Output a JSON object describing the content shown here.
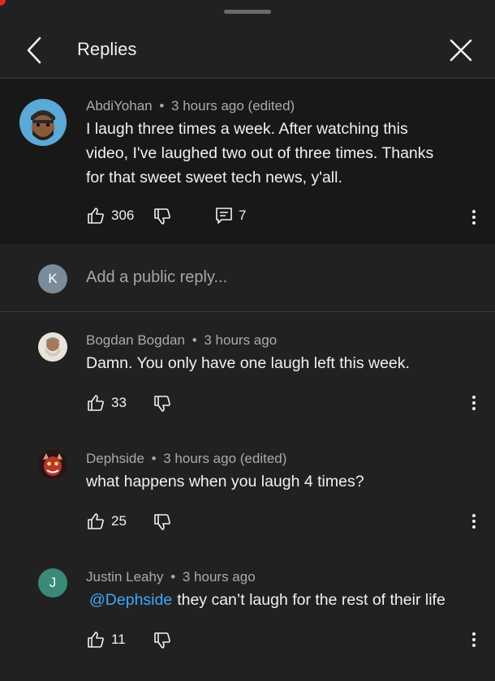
{
  "header": {
    "title": "Replies",
    "back_icon": "chevron-left-icon",
    "close_icon": "close-icon"
  },
  "parent_comment": {
    "author": "AbdiYohan",
    "time": "3 hours ago (edited)",
    "text_lines": [
      "I laugh three times a week. After watching this",
      "video, I've laughed two out of three times. Thanks",
      "for that sweet sweet tech news, y'all."
    ],
    "likes": "306",
    "reply_count": "7"
  },
  "reply_input": {
    "avatar_letter": "K",
    "placeholder": "Add a public reply..."
  },
  "replies": [
    {
      "author": "Bogdan Bogdan",
      "time": "3 hours ago",
      "text": "Damn. You only have one laugh left this week.",
      "likes": "33"
    },
    {
      "author": "Dephside",
      "time": "3 hours ago (edited)",
      "text": "what happens when you laugh 4 times?",
      "likes": "25"
    },
    {
      "author": "Justin Leahy",
      "avatar_letter": "J",
      "time": "3 hours ago",
      "mention": "@Dephside",
      "text": "they can’t laugh for the rest of their life",
      "likes": "11"
    }
  ],
  "separator": "•",
  "colors": {
    "background": "#212121",
    "parent_background": "#181818",
    "mention": "#3ea6ff",
    "avatar_k": "#7a8c99",
    "avatar_j": "#3b8a78"
  }
}
